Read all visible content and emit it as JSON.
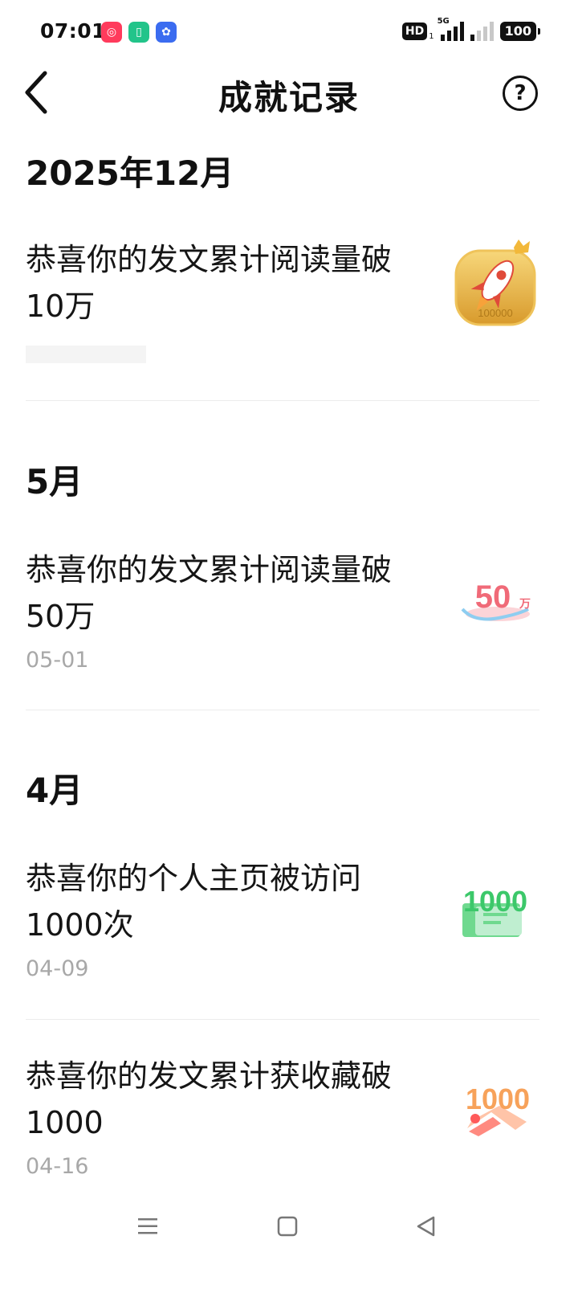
{
  "status_bar": {
    "time": "07:01",
    "hd_label": "HD",
    "sim_sub": "1",
    "network_label": "5G",
    "battery": "100"
  },
  "header": {
    "title": "成就记录",
    "help_label": "?"
  },
  "sections": [
    {
      "month": "2025年12月",
      "records": [
        {
          "title": "恭喜你的发文累计阅读量破10万",
          "date": "",
          "badge": "rocket-medal-icon",
          "badge_text": "100000"
        }
      ]
    },
    {
      "month": "5月",
      "records": [
        {
          "title": "恭喜你的发文累计阅读量破50万",
          "date": "05-01",
          "badge": "50w-badge-icon",
          "badge_text": "50",
          "badge_unit": "万"
        }
      ]
    },
    {
      "month": "4月",
      "records": [
        {
          "title": "恭喜你的个人主页被访问1000次",
          "date": "04-09",
          "badge": "1000-visits-badge-icon",
          "badge_text": "1000"
        },
        {
          "title": "恭喜你的发文累计获收藏破1000",
          "date": "04-16",
          "badge": "1000-favorites-badge-icon",
          "badge_text": "1000"
        }
      ]
    }
  ],
  "colors": {
    "text_primary": "#111111",
    "text_secondary": "#a8a8a8",
    "divider": "#ececec",
    "gold": "#e6b64a",
    "pink": "#f06a78",
    "green": "#3cc86a",
    "orange": "#f7a25a"
  }
}
